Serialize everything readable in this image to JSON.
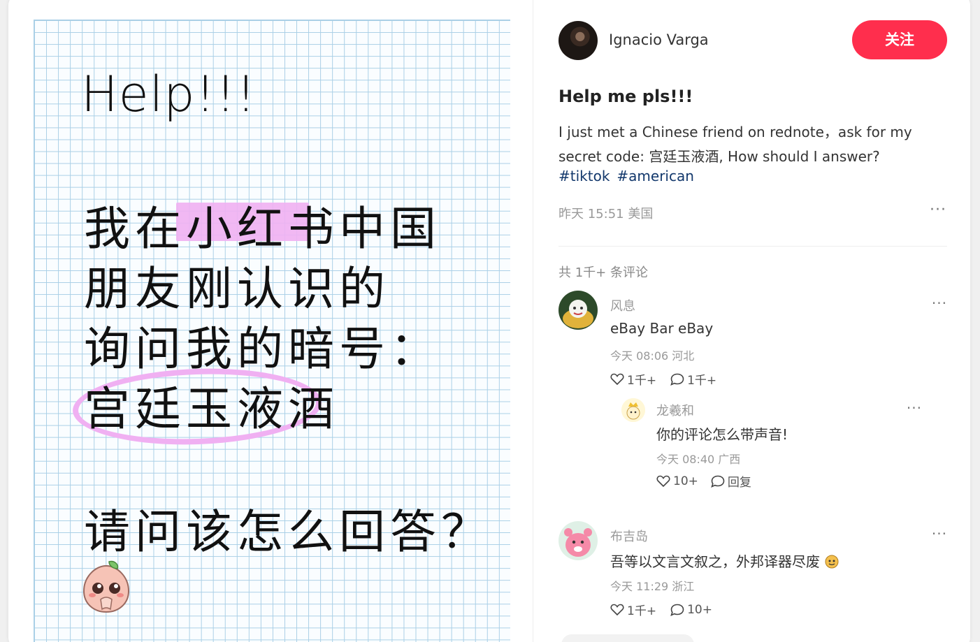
{
  "image": {
    "help_title": "Help!!!",
    "cn_lines": [
      "我在小红书中国",
      "朋友刚认识的",
      "询问我的暗号：",
      "宫廷玉液酒",
      "请问该怎么回答？"
    ],
    "highlight_color": "#f0b0f2",
    "grid_color": "#a9cfe6",
    "emoji": "crying-peach-icon"
  },
  "author": {
    "name": "Ignacio Varga",
    "follow_label": "关注"
  },
  "post": {
    "title": "Help me pls!!!",
    "body": "I just met a Chinese friend on rednote，ask for my secret code: 宫廷玉液酒, How should I answer?",
    "tags": [
      "#tiktok",
      "#american"
    ],
    "meta": "昨天 15:51 美国",
    "more": "···"
  },
  "comments_header": "共 1千+ 条评论",
  "comments": [
    {
      "name": "风息",
      "text": "eBay Bar eBay",
      "time": "今天 08:06 河北",
      "likes": "1千+",
      "replies": "1千+",
      "more": "···"
    },
    {
      "name": "布吉岛",
      "text": "吾等以文言文叙之，外邦译器尽废",
      "time": "今天 11:29 浙江",
      "likes": "1千+",
      "replies": "10+",
      "more": "···"
    }
  ],
  "reply": {
    "name": "龙羲和",
    "text": "你的评论怎么带声音!",
    "time": "今天 08:40 广西",
    "likes": "10+",
    "reply_label": "回复",
    "more": "···"
  },
  "colors": {
    "accent": "#ff2e4d",
    "tag": "#13386c"
  }
}
